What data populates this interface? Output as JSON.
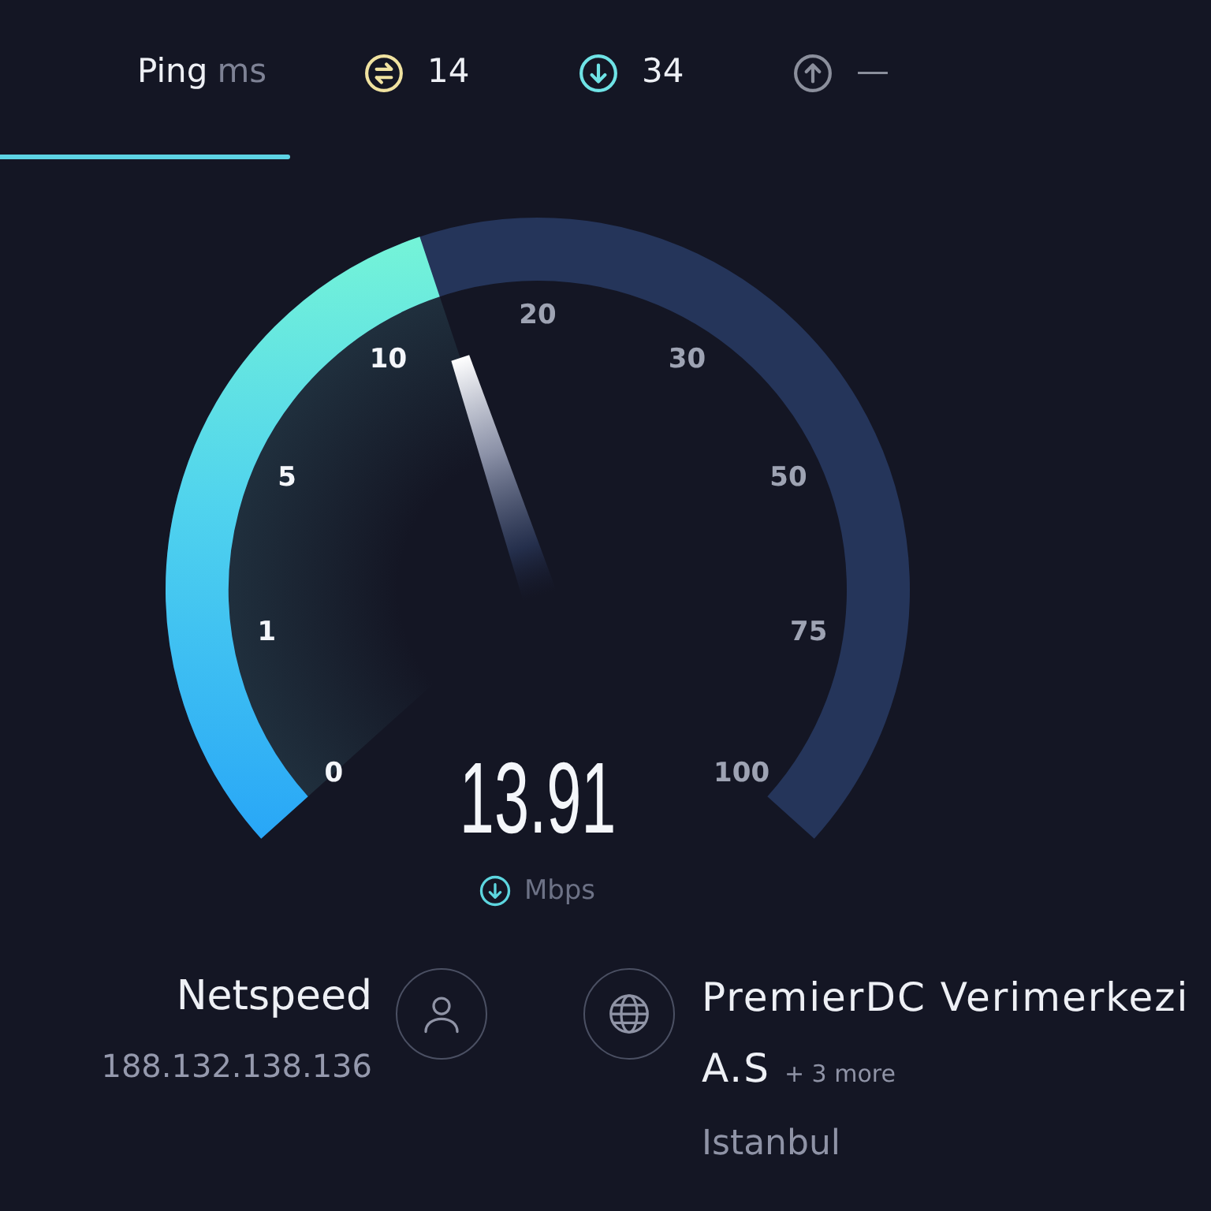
{
  "ping": {
    "label": "Ping",
    "unit": "ms",
    "metrics": [
      {
        "kind": "idle",
        "value": "14",
        "color": "#f0e2a0",
        "pending": false
      },
      {
        "kind": "download",
        "value": "34",
        "color": "#6fe3e6",
        "pending": false
      },
      {
        "kind": "upload",
        "value": "—",
        "color": "#8b8f9c",
        "pending": true
      }
    ]
  },
  "progress": {
    "level": 0.24
  },
  "gauge": {
    "ticks": [
      "0",
      "1",
      "5",
      "10",
      "20",
      "30",
      "50",
      "75",
      "100"
    ],
    "level": 0.43,
    "value": "13.91",
    "unit": "Mbps"
  },
  "provider": {
    "name": "Netspeed",
    "ip": "188.132.138.136"
  },
  "server": {
    "name": "PremierDC Verimerkezi A.S",
    "more": "+ 3 more",
    "location": "Istanbul"
  }
}
